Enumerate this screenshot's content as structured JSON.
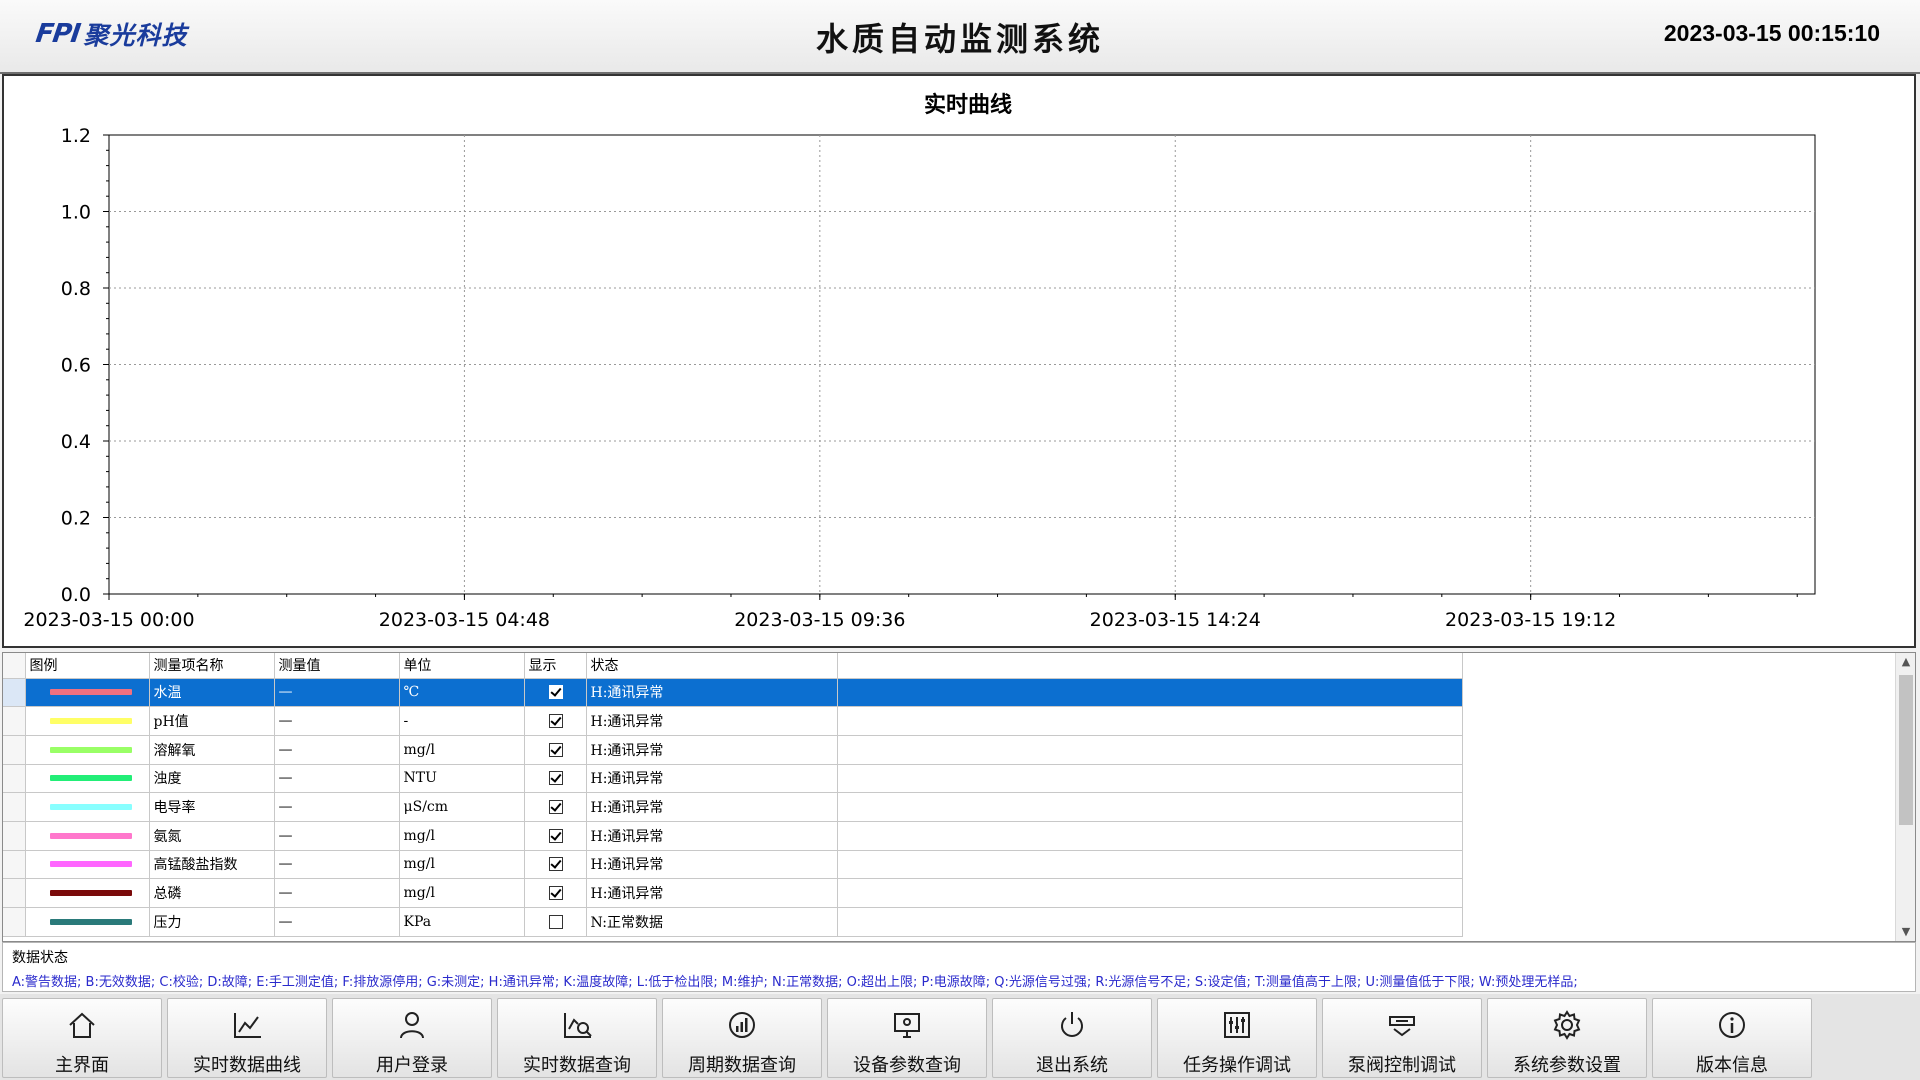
{
  "header": {
    "logo_mark": "FPI",
    "logo_text": "聚光科技",
    "title": "水质自动监测系统",
    "datetime": "2023-03-15 00:15:10"
  },
  "chart_data": {
    "type": "line",
    "title": "实时曲线",
    "xlabel": "",
    "ylabel": "",
    "x_ticks": [
      "2023-03-15 00:00",
      "2023-03-15 04:48",
      "2023-03-15 09:36",
      "2023-03-15 14:24",
      "2023-03-15 19:12"
    ],
    "y_ticks": [
      "0.0",
      "0.2",
      "0.4",
      "0.6",
      "0.8",
      "1.0",
      "1.2"
    ],
    "ylim": [
      0,
      1.2
    ],
    "grid": true,
    "series": []
  },
  "table": {
    "headers": [
      "图例",
      "测量项名称",
      "测量值",
      "单位",
      "显示",
      "状态"
    ],
    "rows": [
      {
        "color": "#f07080",
        "name": "水温",
        "value": "—",
        "unit": "℃",
        "shown": true,
        "status": "H:通讯异常"
      },
      {
        "color": "#ffff66",
        "name": "pH值",
        "value": "—",
        "unit": "-",
        "shown": true,
        "status": "H:通讯异常"
      },
      {
        "color": "#99ff66",
        "name": "溶解氧",
        "value": "—",
        "unit": "mg/l",
        "shown": true,
        "status": "H:通讯异常"
      },
      {
        "color": "#22ee77",
        "name": "浊度",
        "value": "—",
        "unit": "NTU",
        "shown": true,
        "status": "H:通讯异常"
      },
      {
        "color": "#88ffff",
        "name": "电导率",
        "value": "—",
        "unit": "μS/cm",
        "shown": true,
        "status": "H:通讯异常"
      },
      {
        "color": "#ff77cc",
        "name": "氨氮",
        "value": "—",
        "unit": "mg/l",
        "shown": true,
        "status": "H:通讯异常"
      },
      {
        "color": "#ff66ff",
        "name": "高锰酸盐指数",
        "value": "—",
        "unit": "mg/l",
        "shown": true,
        "status": "H:通讯异常"
      },
      {
        "color": "#7a0a0a",
        "name": "总磷",
        "value": "—",
        "unit": "mg/l",
        "shown": true,
        "status": "H:通讯异常"
      },
      {
        "color": "#2a7a7a",
        "name": "压力",
        "value": "—",
        "unit": "KPa",
        "shown": false,
        "status": "N:正常数据"
      }
    ],
    "selected_index": 0
  },
  "status_legend": {
    "title": "数据状态",
    "text": "A:警告数据;   B:无效数据;   C:校验;   D:故障;   E:手工测定值;   F:排放源停用;   G:未测定;   H:通讯异常;   K:温度故障;   L:低于检出限;   M:维护;   N:正常数据;   O:超出上限;   P:电源故障;   Q:光源信号过强;   R:光源信号不足;   S:设定值;   T:测量值高于上限;   U:测量值低于下限;   W:预处理无样品;"
  },
  "nav": [
    {
      "label": "主界面",
      "icon": "home-icon"
    },
    {
      "label": "实时数据曲线",
      "icon": "line-chart-icon"
    },
    {
      "label": "用户登录",
      "icon": "user-icon"
    },
    {
      "label": "实时数据查询",
      "icon": "chart-search-icon"
    },
    {
      "label": "周期数据查询",
      "icon": "signal-chart-icon"
    },
    {
      "label": "设备参数查询",
      "icon": "monitor-icon"
    },
    {
      "label": "退出系统",
      "icon": "power-icon"
    },
    {
      "label": "任务操作调试",
      "icon": "sliders-icon"
    },
    {
      "label": "泵阀控制调试",
      "icon": "valve-icon"
    },
    {
      "label": "系统参数设置",
      "icon": "gear-icon"
    },
    {
      "label": "版本信息",
      "icon": "info-icon"
    }
  ]
}
